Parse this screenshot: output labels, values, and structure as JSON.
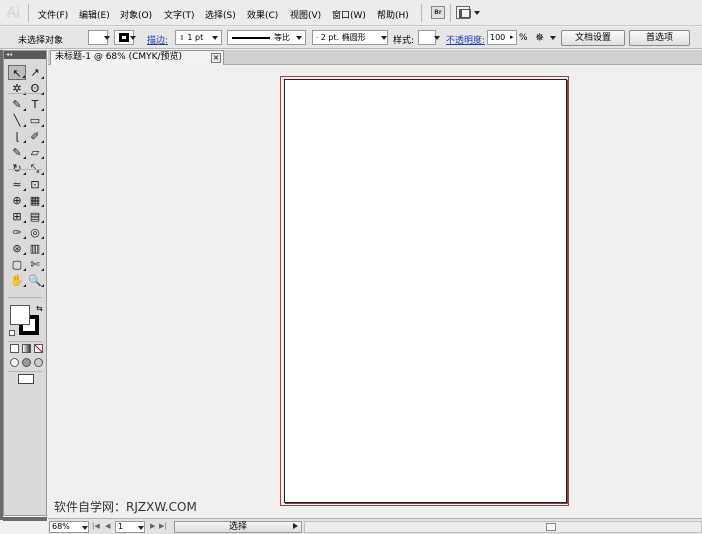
{
  "app": {
    "logo": "Ai"
  },
  "menu": [
    "文件(F)",
    "编辑(E)",
    "对象(O)",
    "文字(T)",
    "选择(S)",
    "效果(C)",
    "视图(V)",
    "窗口(W)",
    "帮助(H)"
  ],
  "menu_icons": {
    "bridge": "Br",
    "arrange": "arrange-documents-icon"
  },
  "control": {
    "selection_label": "未选择对象",
    "stroke_label": "描边:",
    "stroke_weight": "1 pt",
    "stroke_profile": "等比",
    "brush": "2 pt. 椭圆形",
    "style_label": "样式:",
    "opacity_label": "不透明度:",
    "opacity_value": "100",
    "opacity_unit": "%",
    "doc_setup": "文档设置",
    "preferences": "首选项"
  },
  "document": {
    "tab_title": "未标题-1 @ 68% (CMYK/预览)",
    "close": "×"
  },
  "tools": [
    "selection-tool",
    "direct-selection-tool",
    "magic-wand-tool",
    "lasso-tool",
    "pen-tool",
    "type-tool",
    "line-segment-tool",
    "rectangle-tool",
    "paintbrush-tool",
    "pencil-tool",
    "blob-brush-tool",
    "eraser-tool",
    "rotate-tool",
    "scale-tool",
    "width-tool",
    "free-transform-tool",
    "shape-builder-tool",
    "perspective-grid-tool",
    "mesh-tool",
    "gradient-tool",
    "eyedropper-tool",
    "blend-tool",
    "symbol-sprayer-tool",
    "column-graph-tool",
    "artboard-tool",
    "slice-tool",
    "hand-tool",
    "zoom-tool"
  ],
  "tool_glyphs": [
    "↖",
    "↗",
    "✲",
    "ʘ",
    "✎",
    "T",
    "╲",
    "▭",
    "ɭ",
    "✐",
    "✎",
    "▱",
    "↻",
    "⤡",
    "≈",
    "⊡",
    "⊕",
    "▦",
    "⊞",
    "▤",
    "✑",
    "◎",
    "⊛",
    "▥",
    "▢",
    "✄",
    "✋",
    "🔍"
  ],
  "watermark": "软件自学网：RJZXW.COM",
  "status": {
    "zoom": "68%",
    "page": "1",
    "nav_first": "|◀",
    "nav_prev": "◀",
    "nav_next": "▶",
    "nav_last": "▶|",
    "mode": "选择",
    "scroll_left": "◂"
  },
  "colors": {
    "artboard_bleed": "#b03a3a",
    "link": "#1a3fb0"
  }
}
